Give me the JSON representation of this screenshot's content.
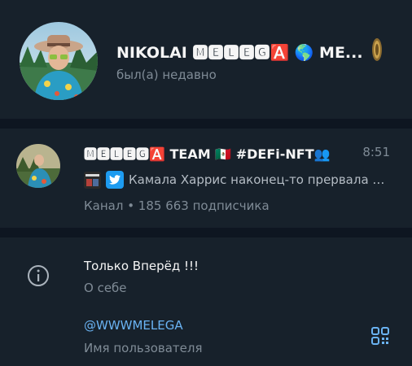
{
  "profile": {
    "name": "NIKOLAI 🅼🅴🅻🅴🅶🅰️ 🌎 ME...",
    "status": "был(а) недавно",
    "avatar_icon": "avatar-photo"
  },
  "channel": {
    "title": "🅼🅴🅻🅴🅶🅰️ TEAM 🇲🇽 #DEFi-NFT👥",
    "time": "8:51",
    "preview": "Камала Харрис наконец-то прервала …",
    "subtitle": "Канал • 185 663 подписчика"
  },
  "info": {
    "about_value": "Только Вперёд !!!",
    "about_label": "О себе",
    "username_value": "@WWWMELEGA",
    "username_label": "Имя пользователя"
  },
  "colors": {
    "background": "#17212b",
    "divider": "#0e1621",
    "secondary_text": "#7f8b96",
    "link": "#6ab3f3"
  }
}
